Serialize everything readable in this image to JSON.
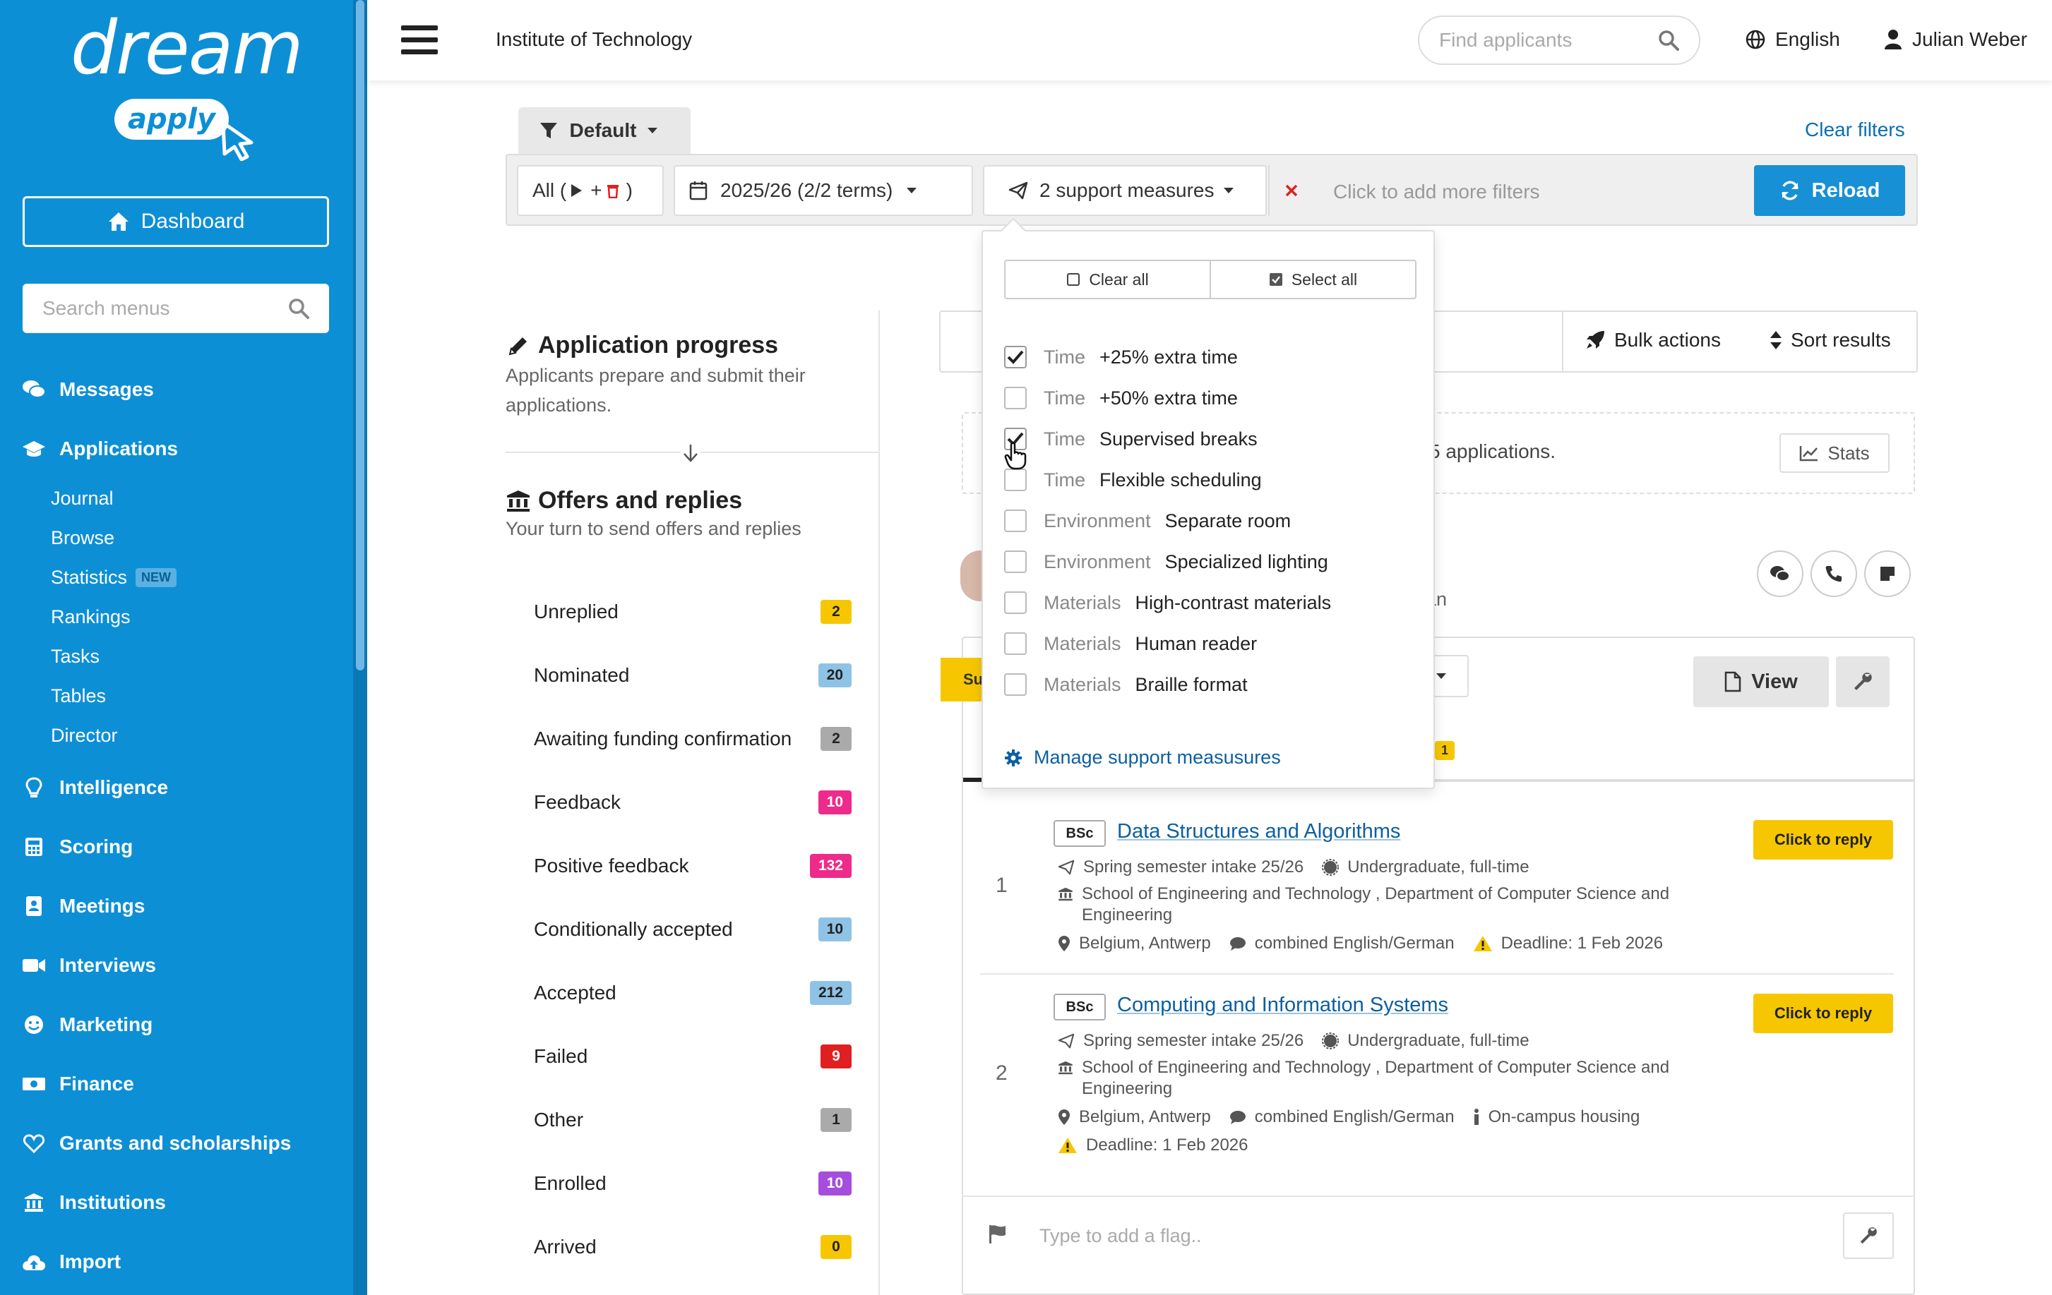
{
  "sidebar": {
    "logo_text": "dream",
    "logo_sub": "apply",
    "dashboard_label": "Dashboard",
    "search_placeholder": "Search menus",
    "items": [
      {
        "label": "Messages",
        "icon": "comments-icon"
      },
      {
        "label": "Applications",
        "icon": "graduation-cap-icon"
      },
      {
        "label": "Intelligence",
        "icon": "lightbulb-icon"
      },
      {
        "label": "Scoring",
        "icon": "calculator-icon"
      },
      {
        "label": "Meetings",
        "icon": "address-book-icon"
      },
      {
        "label": "Interviews",
        "icon": "video-icon"
      },
      {
        "label": "Marketing",
        "icon": "smile-icon"
      },
      {
        "label": "Finance",
        "icon": "money-icon"
      },
      {
        "label": "Grants and scholarships",
        "icon": "heart-icon"
      },
      {
        "label": "Institutions",
        "icon": "institution-icon"
      },
      {
        "label": "Import",
        "icon": "cloud-upload-icon"
      }
    ],
    "sub_items": [
      "Journal",
      "Browse",
      "Statistics",
      "Rankings",
      "Tasks",
      "Tables",
      "Director"
    ],
    "new_badge": "NEW"
  },
  "topbar": {
    "institution": "Institute of Technology",
    "find_placeholder": "Find applicants",
    "language": "English",
    "user": "Julian Weber"
  },
  "filters": {
    "preset": "Default",
    "clear_filters": "Clear filters",
    "all_chip_prefix": "All (",
    "all_chip_plus": "+",
    "all_chip_suffix": ")",
    "terms_chip": "2025/26 (2/2 terms)",
    "support_chip": "2 support measures",
    "add_more": "Click to add more filters",
    "reload": "Reload"
  },
  "dropdown": {
    "clear_all": "Clear all",
    "select_all": "Select all",
    "options": [
      {
        "category": "Time",
        "label": "+25% extra time",
        "checked": true
      },
      {
        "category": "Time",
        "label": "+50% extra time",
        "checked": false
      },
      {
        "category": "Time",
        "label": "Supervised breaks",
        "checked": true
      },
      {
        "category": "Time",
        "label": "Flexible scheduling",
        "checked": false
      },
      {
        "category": "Environment",
        "label": "Separate room",
        "checked": false
      },
      {
        "category": "Environment",
        "label": "Specialized lighting",
        "checked": false
      },
      {
        "category": "Materials",
        "label": "High-contrast materials",
        "checked": false
      },
      {
        "category": "Materials",
        "label": "Human reader",
        "checked": false
      },
      {
        "category": "Materials",
        "label": "Braille format",
        "checked": false
      }
    ],
    "manage": "Manage support measusures"
  },
  "progress": {
    "title": "Application progress",
    "desc": "Applicants prepare and submit their applications.",
    "offers_title": "Offers and replies",
    "offers_desc": "Your turn to send offers and replies",
    "statuses": [
      {
        "label": "Unreplied",
        "count": "2",
        "color": "#f6c700",
        "text": "#222"
      },
      {
        "label": "Nominated",
        "count": "20",
        "color": "#8fc3e6",
        "text": "#222"
      },
      {
        "label": "Awaiting funding confirmation",
        "count": "2",
        "color": "#aaaaaa",
        "text": "#222"
      },
      {
        "label": "Feedback",
        "count": "10",
        "color": "#ee2a8a",
        "text": "#fff"
      },
      {
        "label": "Positive feedback",
        "count": "132",
        "color": "#ee2a8a",
        "text": "#fff"
      },
      {
        "label": "Conditionally accepted",
        "count": "10",
        "color": "#8fc3e6",
        "text": "#222"
      },
      {
        "label": "Accepted",
        "count": "212",
        "color": "#8fc3e6",
        "text": "#222"
      },
      {
        "label": "Failed",
        "count": "9",
        "color": "#e02020",
        "text": "#fff"
      },
      {
        "label": "Other",
        "count": "1",
        "color": "#aaaaaa",
        "text": "#222"
      },
      {
        "label": "Enrolled",
        "count": "10",
        "color": "#a64dde",
        "text": "#fff"
      },
      {
        "label": "Arrived",
        "count": "0",
        "color": "#f6c700",
        "text": "#222"
      }
    ]
  },
  "results": {
    "bulk_actions": "Bulk actions",
    "sort_results": "Sort results",
    "info_text": "5 applications.",
    "stats": "Stats",
    "applicant_fragment": "gan",
    "sticker": "Su",
    "view": "View",
    "tab_badge": "1",
    "flag_placeholder": "Type to add a flag..",
    "programs": [
      {
        "num": "1",
        "degree": "BSc",
        "name": "Data Structures and Algorithms",
        "intake": "Spring semester intake 25/26",
        "level": "Undergraduate, full-time",
        "school": "School of Engineering and Technology , Department of Computer Science and Engineering",
        "location": "Belgium, Antwerp",
        "language": "combined English/German",
        "deadline": "Deadline: 1 Feb 2026",
        "reply": "Click to reply"
      },
      {
        "num": "2",
        "degree": "BSc",
        "name": "Computing and Information Systems",
        "intake": "Spring semester intake 25/26",
        "level": "Undergraduate, full-time",
        "school": "School of Engineering and Technology , Department of Computer Science and Engineering",
        "location": "Belgium, Antwerp",
        "language": "combined English/German",
        "housing": "On-campus housing",
        "deadline": "Deadline: 1 Feb 2026",
        "reply": "Click to reply"
      }
    ]
  }
}
